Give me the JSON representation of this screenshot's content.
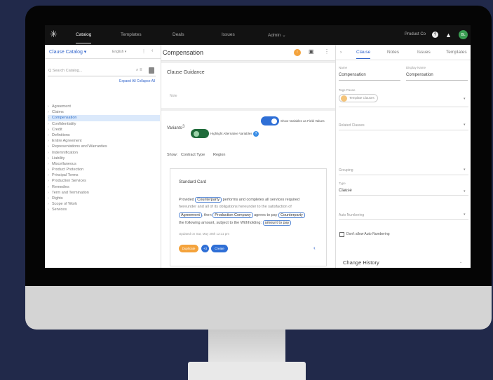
{
  "nav": {
    "tabs": [
      "Catalog",
      "Templates",
      "Deals",
      "Issues",
      "Admin ⌄"
    ],
    "user_label": "Product Co",
    "avatar": "BL"
  },
  "left": {
    "catalog_title": "Clause Catalog ▾",
    "filter": "English ▾",
    "search_placeholder": "Q Search Catalog...",
    "expand_collapse": "Expand All  Collapse All",
    "items": [
      "Agreement",
      "Claims",
      "Compensation",
      "Confidentiality",
      "Credit",
      "Definitions",
      "Entire Agreement",
      "Representations and Warranties",
      "Indemnification",
      "Liability",
      "Miscellaneous",
      "Product Protection",
      "Principal Terms",
      "Production Services",
      "Remedies",
      "Term and Termination",
      "Rights",
      "Scope of Work",
      "Services"
    ],
    "selected_index": 2
  },
  "mid": {
    "title": "Compensation",
    "guidance_title": "Clause Guidance",
    "guidance_placeholder": "Note",
    "variants_label": "Variants",
    "variants_count": "3",
    "toggle1_label": "Show Variables as Field Values",
    "toggle2_label": "Highlight Alternative Variables",
    "filters": [
      "Show:",
      "Contract Type",
      "Region"
    ],
    "variant_title": "Standard Card",
    "clause_text": {
      "l1a": "Provided",
      "p1": "Counterparty",
      "l1b": "performs and completes all services required",
      "l2": "hereunder and all of its obligations hereunder to the satisfaction of",
      "p2": "Agreement",
      "l3a": ", then",
      "p3": "Production Company",
      "l3b": "agrees to pay",
      "p4": "Counterparty",
      "l4a": "the following amount, subject to the Withholding:",
      "p5": "amount to pay"
    },
    "updated": "Updated on Sat, May 28th 12:11 pm",
    "btn_duplicate": "Duplicate",
    "btn_count": "+3",
    "btn_create": "Create",
    "nav_arrow": "‹"
  },
  "right": {
    "tabs": [
      "›",
      "Clause",
      "Notes",
      "Issues",
      "Templates"
    ],
    "name_label": "Name",
    "name_value": "Compensation",
    "display_label": "Display Name",
    "display_value": "Compensation",
    "tags_label": "Tags Pause",
    "template_chip": "Template Clauses",
    "related_label": "Related Clauses",
    "grouping_label": "Grouping",
    "type_label": "Type",
    "type_value": "Clause",
    "numbering_label": "Auto Numbering",
    "checkbox_label": "Don't allow Auto Numbering",
    "change_history": "Change History"
  },
  "colors": {
    "accent": "#3366cc",
    "background": "#21294a",
    "duplicate": "#f4a33c",
    "toggle_green": "#1f6b3a"
  }
}
